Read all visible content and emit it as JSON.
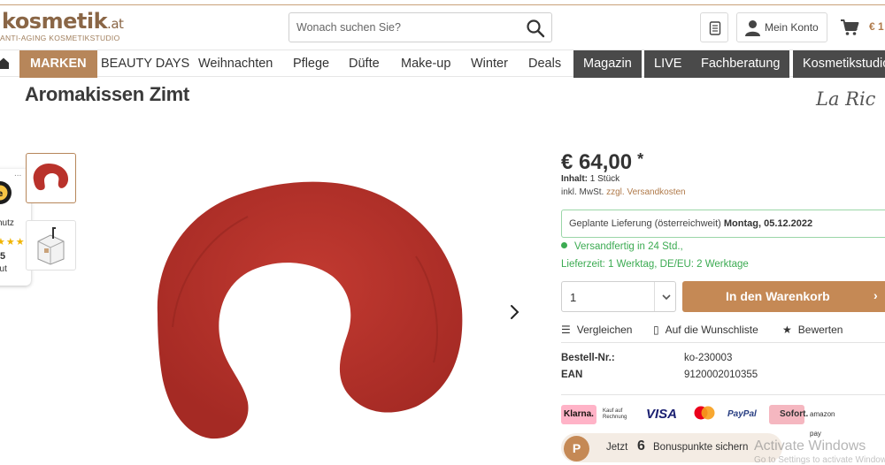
{
  "header": {
    "logo_main": "kosmetik",
    "logo_tld": ".at",
    "logo_tagline": "ANTI-AGING KOSMETIKSTUDIO",
    "search_placeholder": "Wonach suchen Sie?",
    "account_label": "Mein Konto",
    "cart_amount": "€ 1"
  },
  "nav": {
    "items": [
      "MARKEN",
      "BEAUTY DAYS",
      "Weihnachten",
      "Pflege",
      "Düfte",
      "Make-up",
      "Winter",
      "Deals",
      "Magazin",
      "LIVE",
      "Fachberatung",
      "Kosmetikstudio"
    ]
  },
  "product": {
    "title": "Aromakissen Zimt",
    "brand": "La Ric",
    "price": "€ 64,00",
    "price_marker": "*",
    "content_label": "Inhalt:",
    "content_value": "1 Stück",
    "tax_prefix": "inkl. MwSt.",
    "tax_link": "zzgl. Versandkosten",
    "delivery_label": "Geplante Lieferung (österreichweit)",
    "delivery_date": "Montag, 05.12.2022",
    "ship_status": "Versandfertig in 24 Std.,",
    "lead_time": "Lieferzeit: 1 Werktag, DE/EU: 2 Werktage",
    "quantity": "1",
    "add_to_cart": "In den Warenkorb",
    "specs": [
      {
        "label": "Bestell-Nr.:",
        "value": "ko-230003"
      },
      {
        "label": "EAN",
        "value": "9120002010355"
      }
    ]
  },
  "actions": {
    "compare": "Vergleichen",
    "wishlist": "Auf die Wunschliste",
    "rate": "Bewerten"
  },
  "payments": {
    "klarna": "Klarna.",
    "invoice": "Kauf auf Rechnung",
    "visa": "VISA",
    "paypal": "PayPal",
    "sofort": "Sofort.",
    "amazon": "amazon pay"
  },
  "bonus": {
    "badge": "P",
    "prefix": "Jetzt",
    "points": "6",
    "suffix": "Bonuspunkte sichern"
  },
  "trust_badge": {
    "more": "...",
    "label": "chutz",
    "stars": "★★★",
    "score": "5",
    "rating_text": "gut"
  },
  "watermark": {
    "title": "Activate Windows",
    "subtitle": "Go to Settings to activate Windows."
  },
  "colors": {
    "accent": "#b7865a",
    "cart_button": "#c58955",
    "nav_dark": "#4a4a4a",
    "status_green": "#3cab52",
    "product_red": "#b9322b"
  }
}
